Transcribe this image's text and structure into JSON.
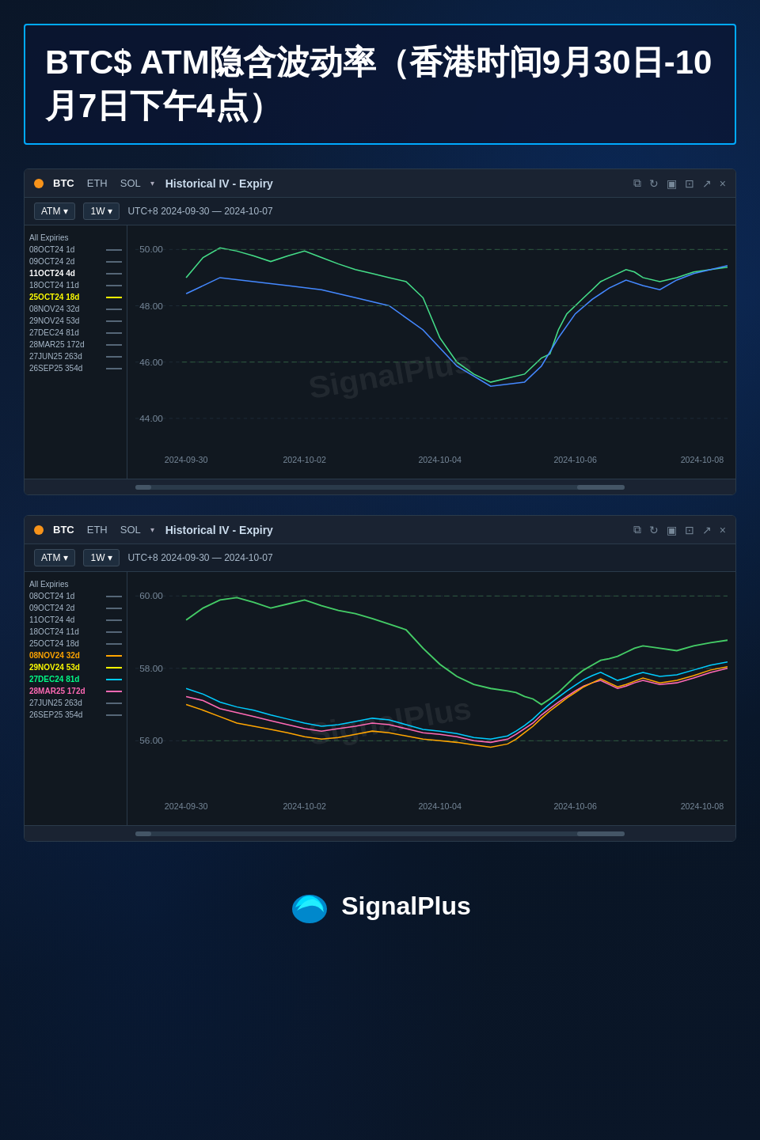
{
  "page": {
    "title": "BTC$ ATM隐含波动率（香港时间9月30日-10月7日下午4点）"
  },
  "chart1": {
    "asset_dot_color": "#f7931a",
    "tabs": [
      "BTC",
      "ETH",
      "SOL"
    ],
    "active_tab": "BTC",
    "title": "Historical IV - Expiry",
    "toolbar": {
      "type": "ATM",
      "interval": "1W",
      "range": "UTC+8 2024-09-30 — 2024-10-07"
    },
    "legend": [
      {
        "label": "All Expiries",
        "highlighted": false
      },
      {
        "label": "08OCT24 1d",
        "highlighted": false
      },
      {
        "label": "09OCT24 2d",
        "highlighted": false
      },
      {
        "label": "11OCT24 4d",
        "highlighted": true,
        "color": "white"
      },
      {
        "label": "18OCT24 11d",
        "highlighted": false
      },
      {
        "label": "25OCT24 18d",
        "highlighted": true,
        "color": "yellow"
      },
      {
        "label": "08NOV24 32d",
        "highlighted": false
      },
      {
        "label": "29NOV24 53d",
        "highlighted": false
      },
      {
        "label": "27DEC24 81d",
        "highlighted": false
      },
      {
        "label": "28MAR25 172d",
        "highlighted": false
      },
      {
        "label": "27JUN25 263d",
        "highlighted": false
      },
      {
        "label": "26SEP25 354d",
        "highlighted": false
      }
    ],
    "x_labels": [
      "2024-09-30",
      "2024-10-02",
      "2024-10-04",
      "2024-10-06",
      "2024-10-08"
    ],
    "y_labels": [
      "50.00",
      "48.00",
      "46.00",
      "44.00"
    ],
    "watermark": "SignalPlus"
  },
  "chart2": {
    "asset_dot_color": "#f7931a",
    "tabs": [
      "BTC",
      "ETH",
      "SOL"
    ],
    "active_tab": "BTC",
    "title": "Historical IV - Expiry",
    "toolbar": {
      "type": "ATM",
      "interval": "1W",
      "range": "UTC+8 2024-09-30 — 2024-10-07"
    },
    "legend": [
      {
        "label": "All Expiries",
        "highlighted": false
      },
      {
        "label": "08OCT24 1d",
        "highlighted": false
      },
      {
        "label": "09OCT24 2d",
        "highlighted": false
      },
      {
        "label": "11OCT24 4d",
        "highlighted": false
      },
      {
        "label": "18OCT24 11d",
        "highlighted": false
      },
      {
        "label": "25OCT24 18d",
        "highlighted": false
      },
      {
        "label": "08NOV24 32d",
        "highlighted": true,
        "color": "orange"
      },
      {
        "label": "29NOV24 53d",
        "highlighted": true,
        "color": "yellow"
      },
      {
        "label": "27DEC24 81d",
        "highlighted": true,
        "color": "cyan"
      },
      {
        "label": "28MAR25 172d",
        "highlighted": true,
        "color": "pink"
      },
      {
        "label": "27JUN25 263d",
        "highlighted": false
      },
      {
        "label": "26SEP25 354d",
        "highlighted": false
      }
    ],
    "x_labels": [
      "2024-09-30",
      "2024-10-02",
      "2024-10-04",
      "2024-10-06",
      "2024-10-08"
    ],
    "y_labels": [
      "60.00",
      "58.00",
      "56.00"
    ],
    "watermark": "SignalPlus"
  },
  "footer": {
    "brand": "SignalPlus"
  },
  "icons": {
    "external_link": "⧉",
    "refresh": "↻",
    "layout": "▣",
    "fullscreen": "⊡",
    "expand": "↗",
    "close": "×",
    "dropdown": "▾"
  }
}
